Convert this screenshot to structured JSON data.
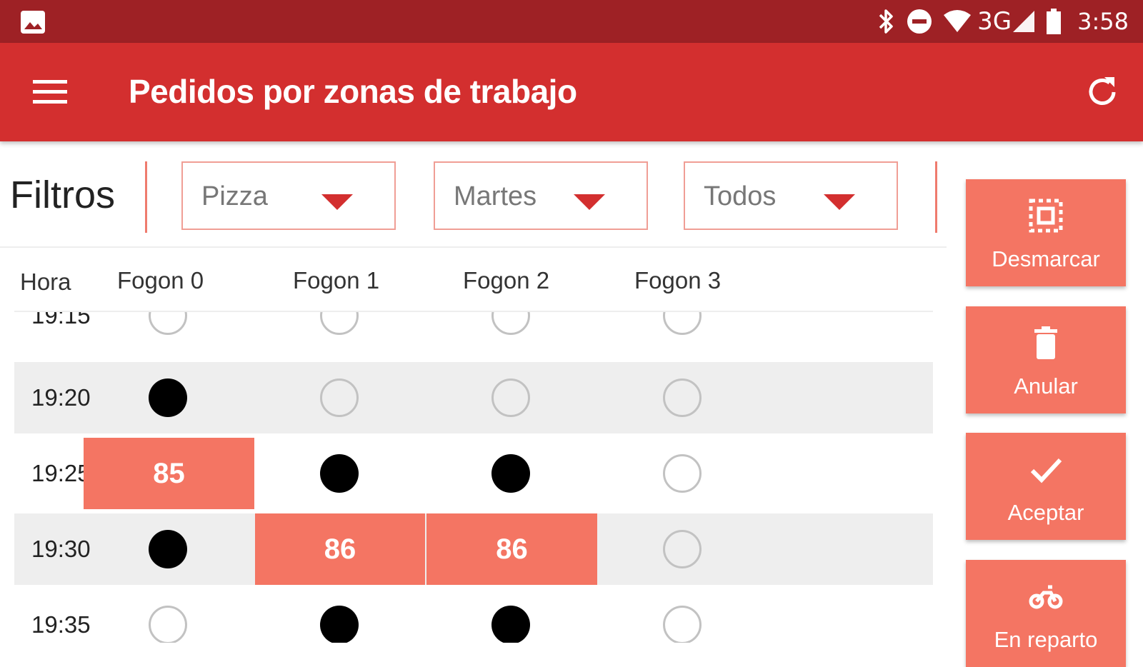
{
  "status_bar": {
    "time": "3:58",
    "network": "3G",
    "icons": [
      "image-icon",
      "bluetooth-icon",
      "do-not-disturb-icon",
      "wifi-icon",
      "signal-icon",
      "battery-icon"
    ]
  },
  "app_bar": {
    "title": "Pedidos por zonas de trabajo",
    "menu_icon": "hamburger-menu-icon",
    "refresh_icon": "refresh-icon"
  },
  "filters": {
    "label": "Filtros",
    "dropdowns": [
      {
        "value": "Pizza"
      },
      {
        "value": "Martes"
      },
      {
        "value": "Todos"
      }
    ]
  },
  "table": {
    "headers": [
      "Hora",
      "Fogon 0",
      "Fogon 1",
      "Fogon 2",
      "Fogon 3"
    ],
    "rows": [
      {
        "time": "19:15",
        "cells": [
          "empty",
          "empty",
          "empty",
          "empty"
        ]
      },
      {
        "time": "19:20",
        "cells": [
          "filled",
          "empty",
          "empty",
          "empty"
        ]
      },
      {
        "time": "19:25",
        "cells": [
          "85",
          "filled",
          "filled",
          "empty"
        ]
      },
      {
        "time": "19:30",
        "cells": [
          "filled",
          "86",
          "86",
          "empty"
        ]
      },
      {
        "time": "19:35",
        "cells": [
          "empty",
          "filled",
          "filled",
          "empty"
        ]
      }
    ]
  },
  "actions": [
    {
      "label": "Desmarcar",
      "icon": "select-all-icon"
    },
    {
      "label": "Anular",
      "icon": "trash-icon"
    },
    {
      "label": "Aceptar",
      "icon": "check-icon"
    },
    {
      "label": "En reparto",
      "icon": "motorbike-icon"
    }
  ],
  "colors": {
    "status_bar": "#9e2125",
    "app_bar": "#d32f2f",
    "accent": "#f47563",
    "row_alt": "#eeeeee"
  }
}
